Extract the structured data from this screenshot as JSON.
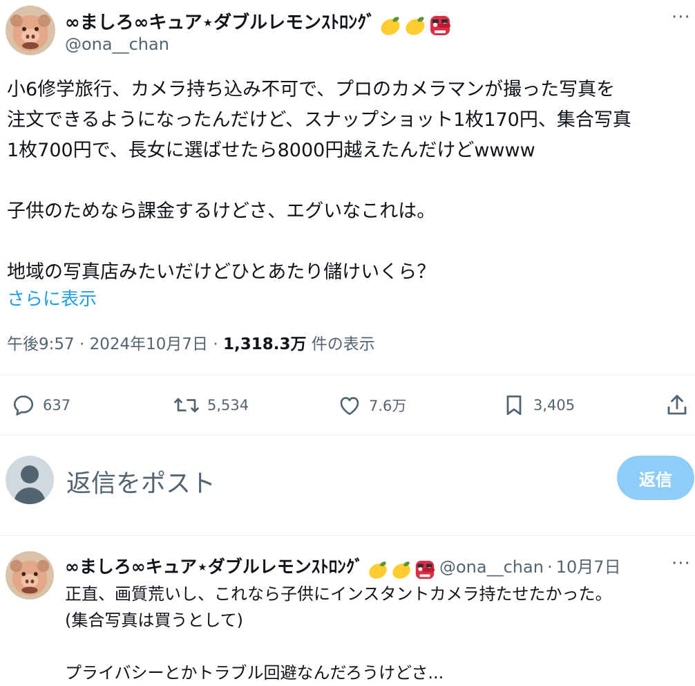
{
  "post": {
    "author": {
      "display_name": "∞ましろ∞キュア⋆ダブルレモンｽﾄﾛﾝｸﾞ",
      "handle": "@ona__chan",
      "avatar": "avatar-photo",
      "name_emojis": [
        "lemon-emoji",
        "lemon-emoji",
        "tengu-mask-emoji"
      ]
    },
    "more_label": "···",
    "body_lines": [
      "小6修学旅行、カメラ持ち込み不可で、プロのカメラマンが撮った写真を",
      "注文できるようになったんだけど、スナップショット1枚170円、集合写真",
      "1枚700円で、長女に選ばせたら8000円越えたんだけどwwww",
      "",
      "子供のためなら課金するけどさ、エグいなこれは。",
      "",
      "地域の写真店みたいだけどひとあたり儲けいくら？"
    ],
    "show_more": "さらに表示",
    "meta": {
      "time": "午後9:57",
      "separator": "·",
      "date": "2024年10月7日",
      "views_count": "1,318.3万",
      "views_label": "件の表示"
    },
    "actions": {
      "reply": {
        "icon": "reply-icon",
        "count": "637"
      },
      "repost": {
        "icon": "repost-icon",
        "count": "5,534"
      },
      "like": {
        "icon": "heart-icon",
        "count": "7.6万"
      },
      "bookmark": {
        "icon": "bookmark-icon",
        "count": "3,405"
      },
      "share": {
        "icon": "share-icon"
      }
    }
  },
  "composer": {
    "placeholder": "返信をポスト",
    "button_label": "返信",
    "avatar": "default-avatar-icon",
    "button_color": "#8ecdf8"
  },
  "reply": {
    "author": {
      "display_name": "∞ましろ∞キュア⋆ダブルレモンｽﾄﾛﾝｸﾞ",
      "handle": "@ona__chan",
      "separator": "·",
      "date": "10月7日",
      "avatar": "avatar-photo"
    },
    "more_label": "···",
    "body_lines": [
      "正直、画質荒いし、これなら子供にインスタントカメラ持たせたかった。",
      "(集合写真は買うとして)",
      "",
      "プライバシーとかトラブル回避なんだろうけどさ..."
    ]
  },
  "colors": {
    "text_primary": "#0f1419",
    "text_secondary": "#536471",
    "link": "#1d9bf0",
    "divider": "#eff3f4"
  }
}
